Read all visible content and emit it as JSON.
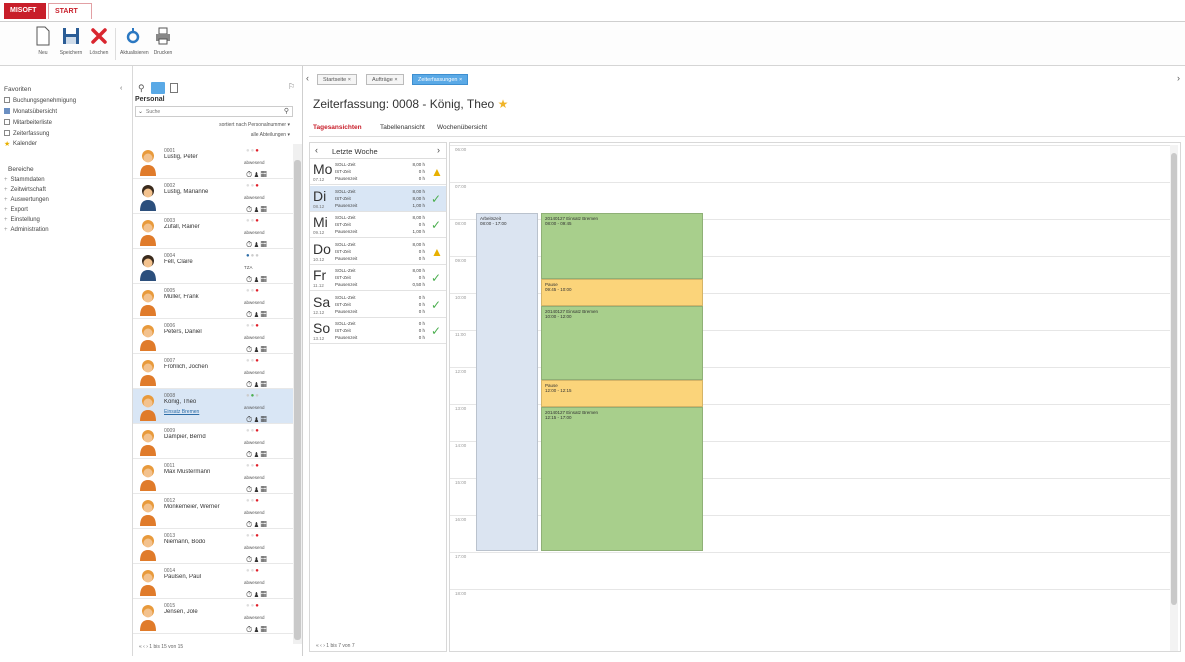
{
  "app": {
    "tab_brand": "MISOFT",
    "tab_start": "START"
  },
  "ribbon": [
    {
      "label": "Neu",
      "icon": "new-doc-icon"
    },
    {
      "label": "Speichern",
      "icon": "save-icon"
    },
    {
      "label": "Löschen",
      "icon": "delete-icon"
    },
    {
      "label": "Aktualisieren",
      "icon": "refresh-icon"
    },
    {
      "label": "Drucken",
      "icon": "print-icon"
    }
  ],
  "favorites": {
    "title": "Favoriten",
    "items": [
      "Buchungsgenehmigung",
      "Monatsübersicht",
      "Mitarbeiterliste",
      "Zeiterfassung",
      "Kalender"
    ],
    "section_title": "Bereiche",
    "sections": [
      "Stammdaten",
      "Zeitwirtschaft",
      "Auswertungen",
      "Export",
      "Einstellung",
      "Administration"
    ]
  },
  "personal": {
    "title": "Personal",
    "search_placeholder": "Suche",
    "sort_label": "sortiert nach Personalnummer",
    "filter_label": "alle Abteilungen",
    "pager": "1 bis 15 von 15",
    "people": [
      {
        "num": "0001",
        "name": "Lustig, Peter",
        "status": "abwesend",
        "avatar": "male"
      },
      {
        "num": "0002",
        "name": "Lustig, Marianne",
        "status": "abwesend",
        "avatar": "female"
      },
      {
        "num": "0003",
        "name": "Zufall, Rainer",
        "status": "abwesend",
        "avatar": "male"
      },
      {
        "num": "0004",
        "name": "Fell, Claire",
        "status": "TZA",
        "avatar": "female"
      },
      {
        "num": "0005",
        "name": "Müller, Frank",
        "status": "abwesend",
        "avatar": "male"
      },
      {
        "num": "0006",
        "name": "Peters, Daniel",
        "status": "abwesend",
        "avatar": "male"
      },
      {
        "num": "0007",
        "name": "Fröhlich, Jochen",
        "status": "abwesend",
        "avatar": "male"
      },
      {
        "num": "0008",
        "name": "König, Theo",
        "status": "anwesend",
        "link": "Einsatz Bremen",
        "avatar": "male",
        "selected": true
      },
      {
        "num": "0009",
        "name": "Dampier, Bernd",
        "status": "abwesend",
        "avatar": "male"
      },
      {
        "num": "0011",
        "name": "Max Mustermann",
        "status": "abwesend",
        "avatar": "male"
      },
      {
        "num": "0012",
        "name": "Monkemeier, Werner",
        "status": "abwesend",
        "avatar": "male"
      },
      {
        "num": "0013",
        "name": "Niemann, Bodo",
        "status": "abwesend",
        "avatar": "male"
      },
      {
        "num": "0014",
        "name": "Paulsen, Paul",
        "status": "abwesend",
        "avatar": "male"
      },
      {
        "num": "0015",
        "name": "Jensen, Jole",
        "status": "abwesend",
        "avatar": "male"
      }
    ]
  },
  "main": {
    "crumbs": [
      "Startseite",
      "Aufträge",
      "Zeiterfassungen"
    ],
    "title": "Zeiterfassung: 0008 - König, Theo",
    "view_tabs": [
      "Tagesansichten",
      "Tabellenansicht",
      "Wochenübersicht"
    ],
    "week_label": "Letzte Woche",
    "week_pager": "1 bis 7 von 7",
    "days": [
      {
        "day": "Mo",
        "date": "07.12",
        "soll": "8,00 h",
        "ist": "0 h",
        "pause": "0 h",
        "state": "warn"
      },
      {
        "day": "Di",
        "date": "08.12",
        "soll": "8,00 h",
        "ist": "8,00 h",
        "pause": "1,00 h",
        "state": "ok",
        "selected": true
      },
      {
        "day": "Mi",
        "date": "09.12",
        "soll": "8,00 h",
        "ist": "0 h",
        "pause": "1,00 h",
        "state": "ok"
      },
      {
        "day": "Do",
        "date": "10.12",
        "soll": "8,00 h",
        "ist": "0 h",
        "pause": "0 h",
        "state": "warn"
      },
      {
        "day": "Fr",
        "date": "11.12",
        "soll": "8,00 h",
        "ist": "0 h",
        "pause": "0,50 h",
        "state": "ok"
      },
      {
        "day": "Sa",
        "date": "12.12",
        "soll": "0 h",
        "ist": "0 h",
        "pause": "0 h",
        "state": "ok"
      },
      {
        "day": "So",
        "date": "13.12",
        "soll": "0 h",
        "ist": "0 h",
        "pause": "0 h",
        "state": "ok"
      }
    ],
    "row_labels": {
      "soll": "SOLL-Zeit",
      "ist": "IST-Zeit",
      "pause": "Pausenzeit"
    },
    "hours": [
      "06:00",
      "07:00",
      "08:00",
      "09:00",
      "10:00",
      "11:00",
      "12:00",
      "13:00",
      "14:00",
      "15:00",
      "16:00",
      "17:00",
      "18:00"
    ],
    "events": {
      "worktime": {
        "title": "Arbeitszeit",
        "time": "08:00 - 17:00",
        "color": "#dbe4f1"
      },
      "block1": {
        "title": "20140127 Einsatz Bremen",
        "time": "08:00 - 09:45",
        "color": "#a8cf8c"
      },
      "pause1": {
        "title": "Pause",
        "time": "09:45 - 10:00",
        "color": "#fbd47a"
      },
      "block2": {
        "title": "20140127 Einsatz Bremen",
        "time": "10:00 - 12:00",
        "color": "#a8cf8c"
      },
      "pause2": {
        "title": "Pause",
        "time": "12:00 - 12:15",
        "color": "#fbd47a"
      },
      "block3": {
        "title": "20140127 Einsatz Bremen",
        "time": "12:15 - 17:00",
        "color": "#a8cf8c"
      }
    }
  },
  "colors": {
    "brand": "#c81e2a",
    "accent": "#5aa9e6",
    "ok": "#4caf50",
    "warn": "#e8b000"
  }
}
